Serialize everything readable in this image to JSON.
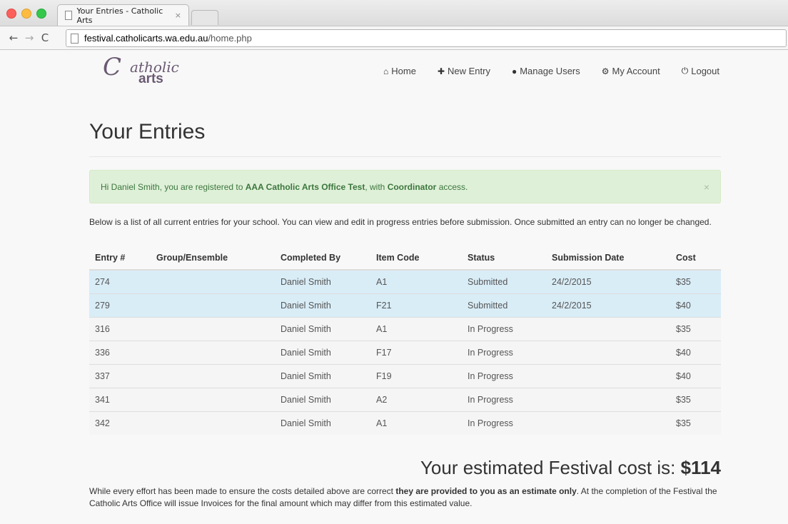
{
  "browser": {
    "tab_title": "Your Entries - Catholic Arts",
    "tab_close": "×",
    "url_host": "festival.catholicarts.wa.edu.au",
    "url_path": "/home.php"
  },
  "site": {
    "logo": {
      "part1": "C",
      "part2": "atholic",
      "part3": "arts"
    },
    "nav": [
      {
        "label": "Home",
        "icon": "home-icon",
        "glyph": "⌂"
      },
      {
        "label": "New Entry",
        "icon": "plus-icon",
        "glyph": "✚"
      },
      {
        "label": "Manage Users",
        "icon": "user-icon",
        "glyph": "👤"
      },
      {
        "label": "My Account",
        "icon": "gear-icon",
        "glyph": "⚙"
      },
      {
        "label": "Logout",
        "icon": "power-icon",
        "glyph": "⏻"
      }
    ]
  },
  "page": {
    "title": "Your Entries",
    "alert": {
      "prefix": "Hi Daniel Smith, you are registered to ",
      "school": "AAA Catholic Arts Office Test",
      "mid": ", with ",
      "role": "Coordinator",
      "suffix": " access.",
      "close": "×"
    },
    "intro": "Below is a list of all current entries for your school. You can view and edit in progress entries before submission. Once submitted an entry can no longer be changed.",
    "table": {
      "headers": [
        "Entry #",
        "Group/Ensemble",
        "Completed By",
        "Item Code",
        "Status",
        "Submission Date",
        "Cost"
      ],
      "rows": [
        [
          "274",
          "",
          "Daniel Smith",
          "A1",
          "Submitted",
          "24/2/2015",
          "$35"
        ],
        [
          "279",
          "",
          "Daniel Smith",
          "F21",
          "Submitted",
          "24/2/2015",
          "$40"
        ],
        [
          "316",
          "",
          "Daniel Smith",
          "A1",
          "In Progress",
          "",
          "$35"
        ],
        [
          "336",
          "",
          "Daniel Smith",
          "F17",
          "In Progress",
          "",
          "$40"
        ],
        [
          "337",
          "",
          "Daniel Smith",
          "F19",
          "In Progress",
          "",
          "$40"
        ],
        [
          "341",
          "",
          "Daniel Smith",
          "A2",
          "In Progress",
          "",
          "$35"
        ],
        [
          "342",
          "",
          "Daniel Smith",
          "A1",
          "In Progress",
          "",
          "$35"
        ]
      ]
    },
    "total": {
      "label": "Your estimated Festival cost is: ",
      "amount": "$114"
    },
    "note": {
      "prefix": "While every effort has been made to ensure the costs detailed above are correct ",
      "bold": "they are provided to you as an estimate only",
      "suffix": ". At the completion of the Festival the Catholic Arts Office will issue Invoices for the final amount which may differ from this estimated value."
    }
  }
}
